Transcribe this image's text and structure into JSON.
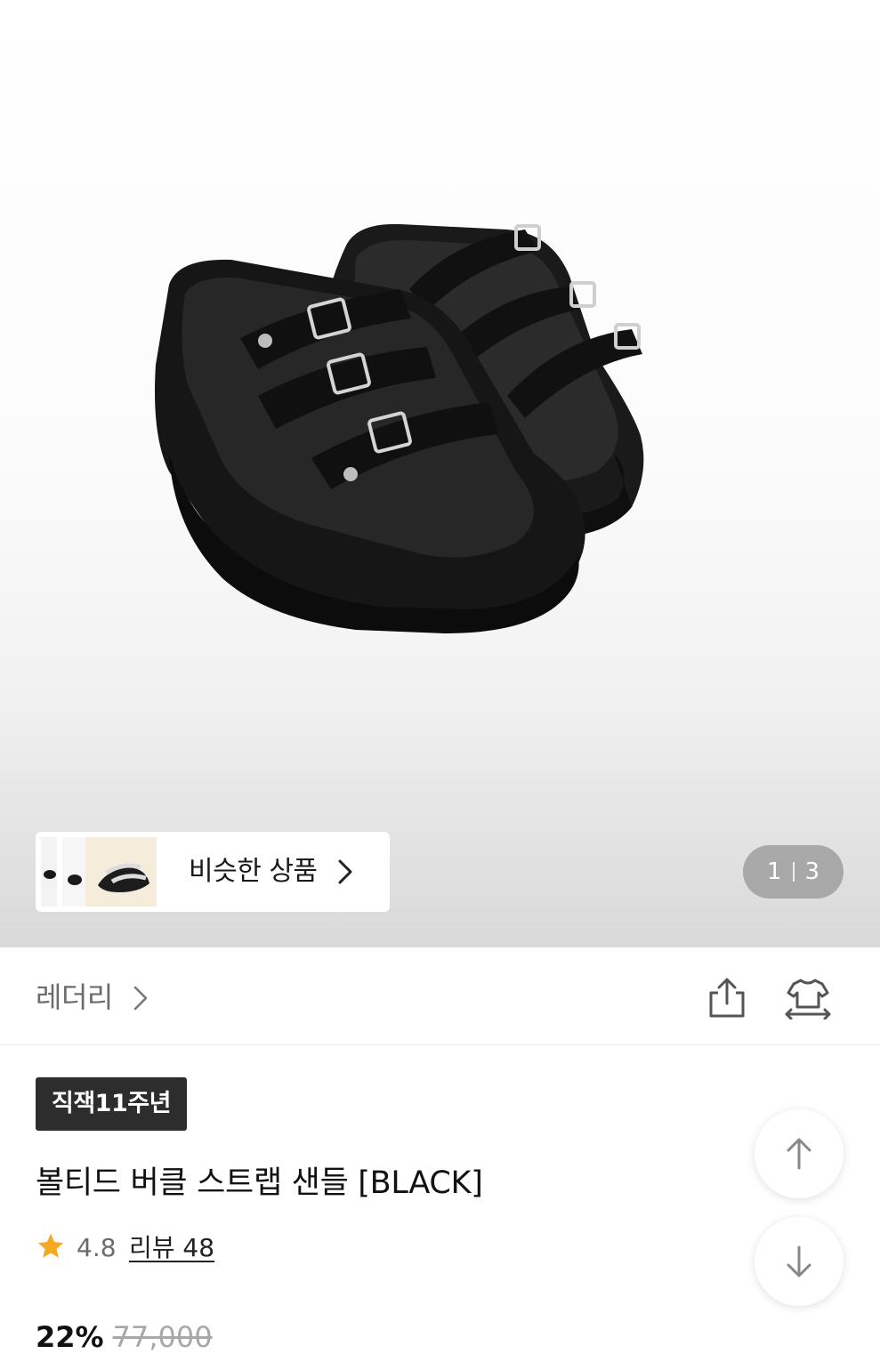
{
  "similar": {
    "label": "비슷한 상품"
  },
  "gallery": {
    "current": "1",
    "total": "3"
  },
  "brand": {
    "name": "레더리"
  },
  "icons": {
    "share": "share-icon",
    "size_compare": "size-compare-icon",
    "star": "star-icon",
    "scroll_up": "arrow-up-icon",
    "scroll_down": "arrow-down-icon",
    "chevron": "chevron-right-icon"
  },
  "product": {
    "badge": "직잭11주년",
    "title": "볼티드 버클 스트랩 샌들 [BLACK]",
    "rating": "4.8",
    "review_label": "리뷰 48",
    "discount": "22%",
    "original_price": "77,000"
  },
  "colors": {
    "star": "#f7a823",
    "badge_bg": "#2d2d2d",
    "indicator_bg": "#969696"
  }
}
